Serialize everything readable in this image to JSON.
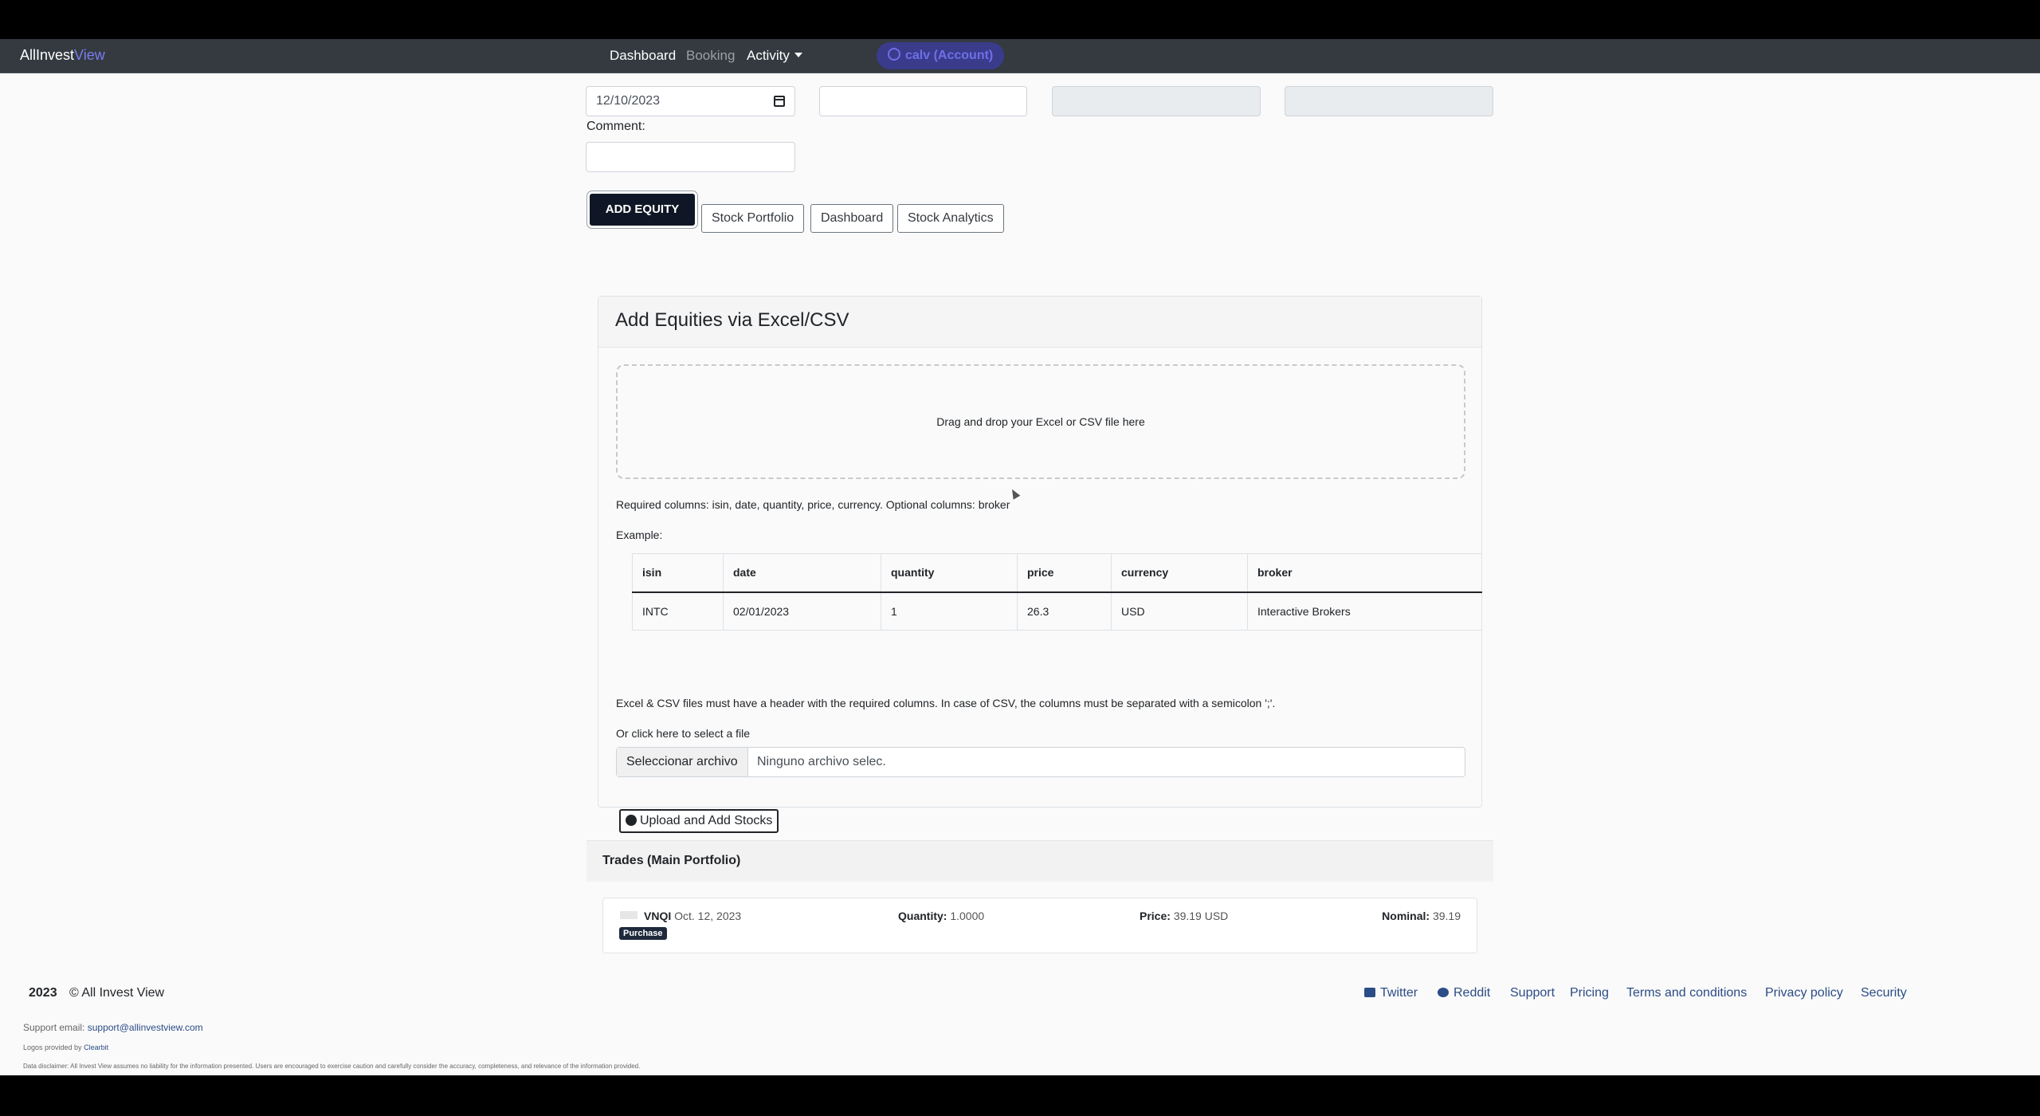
{
  "navbar": {
    "brand_main": "AllInvest",
    "brand_accent": "View",
    "links": [
      "Dashboard",
      "Booking",
      "Activity"
    ],
    "account_label": "calv (Account)"
  },
  "form": {
    "trade_date_value": "12/10/2023",
    "comment_label": "Comment:",
    "add_equity_label": "ADD EQUITY",
    "buttons": [
      "Stock Portfolio",
      "Dashboard",
      "Stock Analytics"
    ]
  },
  "upload": {
    "title": "Add Equities via Excel/CSV",
    "dropzone_text": "Drag and drop your Excel or CSV file here",
    "required_text": "Required columns: isin, date, quantity, price, currency. Optional columns: broker",
    "example_label": "Example:",
    "table": {
      "headers": [
        "isin",
        "date",
        "quantity",
        "price",
        "currency",
        "broker"
      ],
      "row": [
        "INTC",
        "02/01/2023",
        "1",
        "26.3",
        "USD",
        "Interactive Brokers"
      ]
    },
    "note_text": "Excel & CSV files must have a header with the required columns. In case of CSV, the columns must be separated with a semicolon ';'.",
    "click_text": "Or click here to select a file",
    "file_button": "Seleccionar archivo",
    "file_name": "Ninguno archivo selec.",
    "upload_button": "Upload and Add Stocks"
  },
  "trades": {
    "title": "Trades (Main Portfolio)",
    "ticker": "VNQI",
    "date": "Oct. 12, 2023",
    "badge": "Purchase",
    "quantity_label": "Quantity:",
    "quantity_value": "1.0000",
    "price_label": "Price:",
    "price_value": "39.19 USD",
    "nominal_label": "Nominal:",
    "nominal_value": "39.19"
  },
  "footer": {
    "year": "2023",
    "copyright": "© All Invest View",
    "links": [
      "Twitter",
      "Reddit",
      "Support",
      "Pricing",
      "Terms and conditions",
      "Privacy policy",
      "Security"
    ],
    "support_label": "Support email:",
    "support_email": "support@allinvestview.com",
    "logos_label": "Logos provided by",
    "logos_link": "Clearbit",
    "disclaimer": "Data disclaimer: All Invest View assumes no liability for the information presented. Users are encouraged to exercise caution and carefully consider the accuracy, completeness, and relevance of the information provided."
  }
}
